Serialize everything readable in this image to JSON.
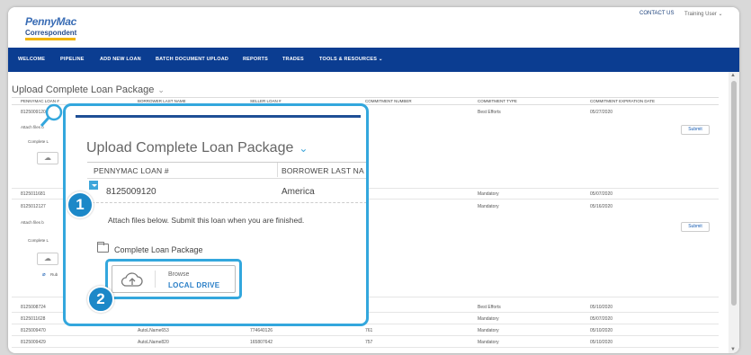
{
  "header": {
    "logo_main": "PennyMac",
    "logo_sub": "Correspondent",
    "contact_link": "CONTACT US",
    "user_menu": "Training User ⌄"
  },
  "nav": {
    "items": [
      "WELCOME",
      "PIPELINE",
      "ADD NEW LOAN",
      "BATCH DOCUMENT UPLOAD",
      "REPORTS",
      "TRADES",
      "TOOLS & RESOURCES ⌄"
    ]
  },
  "page": {
    "title": "Upload Complete Loan Package",
    "title_chevron": "⌄"
  },
  "table": {
    "columns": [
      "PENNYMAC LOAN #",
      "BORROWER LAST NAME",
      "SELLER LOAN #",
      "COMMITMENT NUMBER",
      "COMMITMENT TYPE",
      "COMMITMENT EXPIRATION DATE"
    ],
    "rows": [
      {
        "loan": "8125009120",
        "borrower": "",
        "seller": "",
        "commitment": "",
        "type": "Best Efforts",
        "expiry": "05/27/2020"
      },
      {
        "loan": "8125011681",
        "borrower": "",
        "seller": "",
        "commitment": "",
        "type": "Mandatory",
        "expiry": "05/07/2020"
      },
      {
        "loan": "8125012127",
        "borrower": "",
        "seller": "",
        "commitment": "",
        "type": "Mandatory",
        "expiry": "05/16/2020"
      },
      {
        "loan": "8125008724",
        "borrower": "",
        "seller": "",
        "commitment": "",
        "type": "Best Efforts",
        "expiry": "05/10/2020"
      },
      {
        "loan": "8125011628",
        "borrower": "",
        "seller": "",
        "commitment": "",
        "type": "Mandatory",
        "expiry": "05/07/2020"
      },
      {
        "loan": "8125009470",
        "borrower": "AutoLName653",
        "seller": "774640126",
        "commitment": "761",
        "type": "Mandatory",
        "expiry": "05/10/2020"
      },
      {
        "loan": "8125009429",
        "borrower": "AutoLName820",
        "seller": "165807642",
        "commitment": "757",
        "type": "Mandatory",
        "expiry": "05/10/2020"
      }
    ],
    "expanded_note": "Attach files b",
    "expanded_folder": "Complete L",
    "submit_label": "Submit",
    "file_stub": "Rub"
  },
  "callout": {
    "title": "Upload Complete Loan Package",
    "title_chevron": "⌄",
    "col_loan": "PENNYMAC LOAN #",
    "col_borrower": "BORROWER LAST NA",
    "loan_number": "8125009120",
    "borrower": "America",
    "note": "Attach files below. Submit this loan when you are finished.",
    "folder_label": "Complete Loan Package",
    "browse_label": "Browse",
    "browse_local": "LOCAL DRIVE"
  },
  "badges": {
    "step1": "1",
    "step2": "2"
  },
  "colors": {
    "nav_bg": "#0b3d91",
    "callout_border": "#33a7dd",
    "badge": "#1c88c8",
    "link": "#2a7fc7"
  },
  "icons": [
    "magnifier-icon",
    "cloud-upload-icon",
    "folder-icon",
    "chevron-down-icon",
    "paperclip-icon"
  ]
}
